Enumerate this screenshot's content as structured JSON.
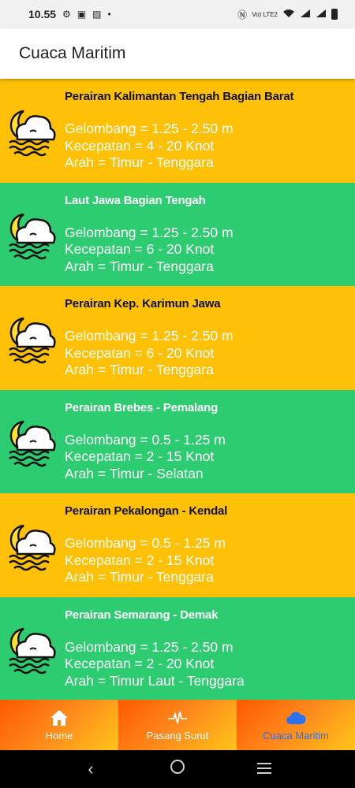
{
  "status_bar": {
    "time": "10.55",
    "network_label": "Vo) LTE2"
  },
  "app_bar": {
    "title": "Cuaca Maritim"
  },
  "icons": {
    "weather": "moon-cloud-waves-icon",
    "home": "home-icon",
    "tide": "pulse-icon",
    "maritime": "cloud-icon"
  },
  "colors": {
    "card_yellow": "#ffc107",
    "card_green": "#2ecc71",
    "nav_active": "#2b72f0"
  },
  "cards": [
    {
      "title": "Perairan Kalimantan Tengah Bagian Barat",
      "wave": "Gelombang = 1.25 - 2.50 m",
      "speed": "Kecepatan = 4 - 20 Knot",
      "direction": "Arah = Timur - Tenggara"
    },
    {
      "title": "Laut Jawa Bagian Tengah",
      "wave": "Gelombang = 1.25 - 2.50 m",
      "speed": "Kecepatan = 6 - 20 Knot",
      "direction": "Arah = Timur - Tenggara"
    },
    {
      "title": "Perairan Kep. Karimun Jawa",
      "wave": "Gelombang = 1.25 - 2.50 m",
      "speed": "Kecepatan = 6 - 20 Knot",
      "direction": "Arah = Timur - Tenggara"
    },
    {
      "title": "Perairan Brebes - Pemalang",
      "wave": "Gelombang = 0.5 - 1.25 m",
      "speed": "Kecepatan = 2 - 15 Knot",
      "direction": "Arah = Timur - Selatan"
    },
    {
      "title": "Perairan Pekalongan - Kendal",
      "wave": "Gelombang = 0.5 - 1.25 m",
      "speed": "Kecepatan = 2 - 15 Knot",
      "direction": "Arah = Timur - Tenggara"
    },
    {
      "title": "Perairan Semarang - Demak",
      "wave": "Gelombang = 1.25 - 2.50 m",
      "speed": "Kecepatan = 2 - 20 Knot",
      "direction": "Arah = Timur Laut - Tenggara"
    }
  ],
  "bottom_nav": {
    "items": [
      {
        "label": "Home",
        "active": false
      },
      {
        "label": "Pasang Surut",
        "active": false
      },
      {
        "label": "Cuaca Maritim",
        "active": true
      }
    ]
  }
}
